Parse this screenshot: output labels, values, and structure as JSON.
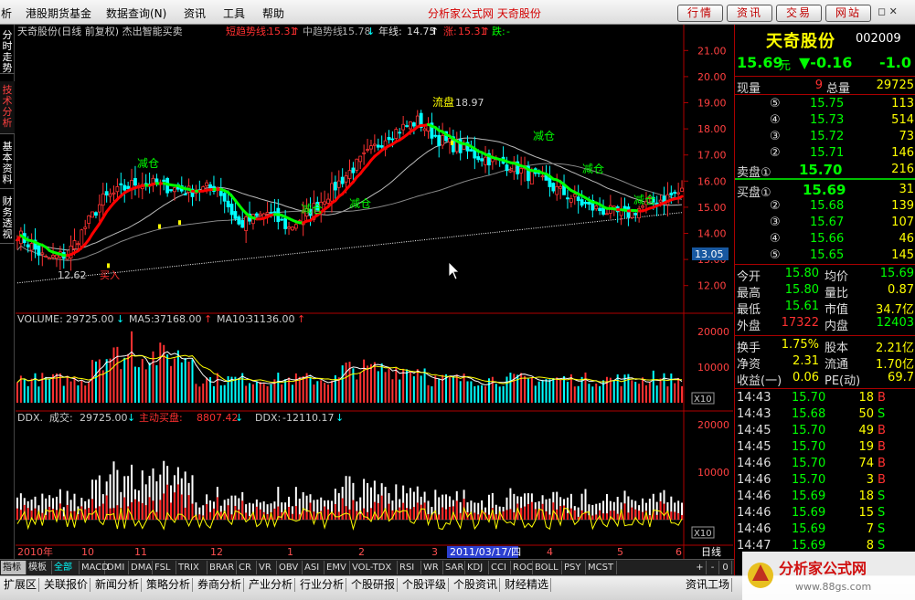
{
  "menu": {
    "items": [
      "析",
      "港股期货基金",
      "数据查询(N)",
      "资讯",
      "工具",
      "帮助"
    ],
    "title": "分析家公式网 天奇股份",
    "buttons": [
      "行情",
      "资讯",
      "交易",
      "网站"
    ]
  },
  "side_tabs": [
    "分时走势",
    "技术分析",
    "基本资料",
    "财务透视"
  ],
  "chart_header": {
    "name": "天奇股份(日线 前复权) 杰出智能买卖",
    "short_label": "短趋势线:",
    "short_value": "15.31",
    "mid_label": "中趋势线:",
    "mid_value": "15.78",
    "year_label": "年线:",
    "year_value": "14.75",
    "rise_label": "涨:",
    "rise_value": "15.31",
    "fall_label": "跌:",
    "fall_value": "-"
  },
  "annotations": {
    "reduce": "减仓",
    "pullback": "流盘",
    "high_value": "18.97",
    "low_value": "12.62",
    "buy": "买入",
    "price_tag": "13.05"
  },
  "volume_header": {
    "vol_label": "VOLUME:",
    "vol_value": "29725.00",
    "ma5_label": "MA5:",
    "ma5_value": "37168.00",
    "ma10_label": "MA10:",
    "ma10_value": "31136.00"
  },
  "ddx_header": {
    "label": "DDX.",
    "deal_label": "成交:",
    "deal_value": "29725.00",
    "main_label": "主动买盘:",
    "main_value": "8807.42",
    "ddx_label": "DDX:",
    "ddx_value": "-12110.17"
  },
  "multiplier": "X10",
  "time_axis": {
    "labels": [
      "2010年",
      "10",
      "11",
      "12",
      "1",
      "2",
      "3",
      "4",
      "5",
      "6",
      "7"
    ],
    "cursor_date": "2011/03/17/四",
    "period": "日线"
  },
  "tab_controls": [
    "+",
    "-",
    "0"
  ],
  "chart_data": {
    "type": "candlestick",
    "price_ticks": [
      21,
      20,
      19,
      18,
      17,
      16,
      15,
      14,
      13,
      12
    ],
    "volume_ticks": [
      20000,
      10000
    ],
    "ddx_ticks": [
      20000,
      10000
    ],
    "price_range": [
      11.5,
      21.5
    ],
    "volume_range": [
      0,
      22000
    ],
    "ddx_range": [
      -5000,
      21000
    ],
    "ohlc_keyframes": [
      [
        0,
        14.0
      ],
      [
        8,
        13.0
      ],
      [
        14,
        13.2
      ],
      [
        24,
        15.3
      ],
      [
        34,
        16.0
      ],
      [
        48,
        15.6
      ],
      [
        56,
        15.8
      ],
      [
        62,
        14.3
      ],
      [
        70,
        14.8
      ],
      [
        76,
        14.2
      ],
      [
        84,
        15.1
      ],
      [
        94,
        16.5
      ],
      [
        104,
        17.8
      ],
      [
        112,
        18.3
      ],
      [
        118,
        17.6
      ],
      [
        128,
        17.0
      ],
      [
        138,
        16.6
      ],
      [
        148,
        15.9
      ],
      [
        160,
        15.0
      ],
      [
        170,
        14.7
      ],
      [
        178,
        15.2
      ],
      [
        186,
        15.6
      ]
    ]
  },
  "quote": {
    "name": "天奇股份",
    "code": "002009",
    "price": "15.69",
    "unit": "元",
    "change": "▼-0.16",
    "pct": "-1.0",
    "now_vol_label": "现量",
    "now_vol": "9",
    "total_vol_label": "总量",
    "total_vol": "29725",
    "sell": [
      {
        "n": "⑤",
        "p": "15.75",
        "v": "113"
      },
      {
        "n": "④",
        "p": "15.73",
        "v": "514"
      },
      {
        "n": "③",
        "p": "15.72",
        "v": "73"
      },
      {
        "n": "②",
        "p": "15.71",
        "v": "146"
      },
      {
        "n": "卖盘①",
        "p": "15.70",
        "v": "216"
      }
    ],
    "buy": [
      {
        "n": "买盘①",
        "p": "15.69",
        "v": "31"
      },
      {
        "n": "②",
        "p": "15.68",
        "v": "139"
      },
      {
        "n": "③",
        "p": "15.67",
        "v": "107"
      },
      {
        "n": "④",
        "p": "15.66",
        "v": "46"
      },
      {
        "n": "⑤",
        "p": "15.65",
        "v": "145"
      }
    ],
    "stats": [
      [
        "今开",
        "15.80",
        "均价",
        "15.69"
      ],
      [
        "最高",
        "15.80",
        "量比",
        "0.87"
      ],
      [
        "最低",
        "15.61",
        "市值",
        "34.7亿"
      ],
      [
        "外盘",
        "17322",
        "内盘",
        "12403"
      ],
      [
        "换手",
        "1.75%",
        "股本",
        "2.21亿"
      ],
      [
        "净资",
        "2.31",
        "流通",
        "1.70亿"
      ],
      [
        "收益(一)",
        "0.06",
        "PE(动)",
        "69.7"
      ]
    ],
    "ticks": [
      [
        "14:43",
        "15.70",
        "18",
        "B"
      ],
      [
        "14:43",
        "15.68",
        "50",
        "S"
      ],
      [
        "14:45",
        "15.70",
        "49",
        "B"
      ],
      [
        "14:45",
        "15.70",
        "19",
        "B"
      ],
      [
        "14:46",
        "15.70",
        "74",
        "B"
      ],
      [
        "14:46",
        "15.70",
        "3",
        "B"
      ],
      [
        "14:46",
        "15.69",
        "18",
        "S"
      ],
      [
        "14:46",
        "15.69",
        "15",
        "S"
      ],
      [
        "14:46",
        "15.69",
        "7",
        "S"
      ],
      [
        "14:47",
        "15.69",
        "8",
        "S"
      ]
    ]
  },
  "bottom_tabs": [
    "指标",
    "模板",
    "全部",
    "MACD",
    "DMI",
    "DMA",
    "FSL",
    "TRIX",
    "BRAR",
    "CR",
    "VR",
    "OBV",
    "ASI",
    "EMV",
    "VOL-TDX",
    "RSI",
    "WR",
    "SAR",
    "KDJ",
    "CCI",
    "ROC",
    "BOLL",
    "PSY",
    "MCST"
  ],
  "status_tabs": [
    "扩展区",
    "关联报价",
    "新闻分析",
    "策略分析",
    "券商分析",
    "产业分析",
    "行业分析",
    "个股研报",
    "个股评级",
    "个股资讯",
    "财经精选",
    "资讯工场"
  ],
  "logo": {
    "text": "分析家公式网",
    "url": "www.88gs.com"
  },
  "colors": {
    "up": "#ff3232",
    "down": "#00ffff",
    "trend_up": "#ff0000",
    "trend_down": "#00ff00",
    "label": "#ffff00",
    "axis": "#b00000"
  }
}
